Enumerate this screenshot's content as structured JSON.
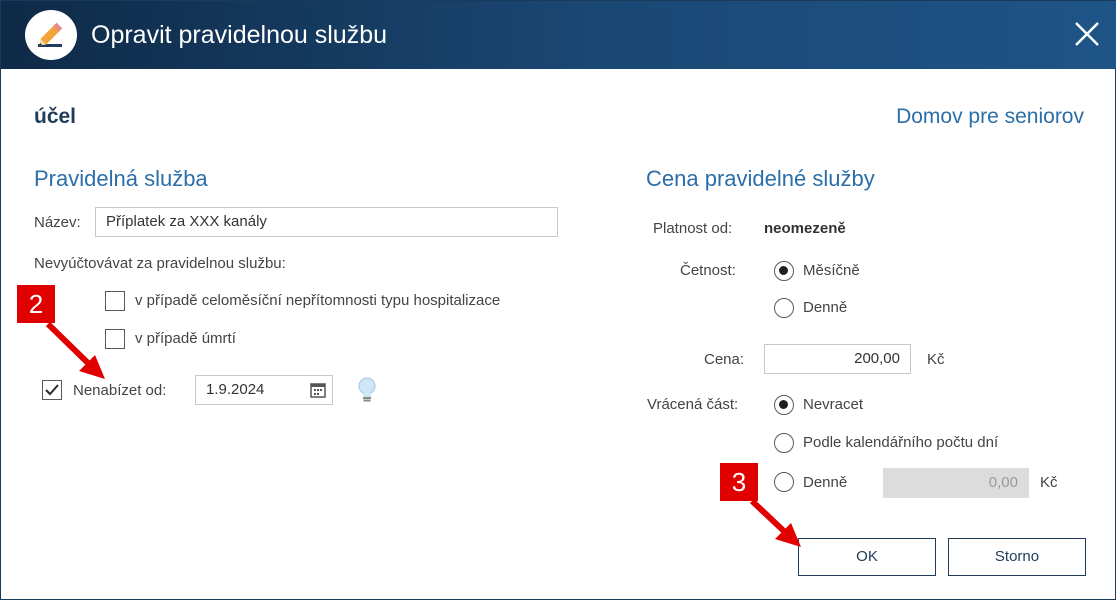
{
  "window": {
    "title": "Opravit pravidelnou službu"
  },
  "purpose": {
    "label": "účel",
    "value": "Domov pre seniorov"
  },
  "left": {
    "section_title": "Pravidelná služba",
    "name_label": "Název:",
    "name_value": "Příplatek za XXX kanály",
    "no_billing_label": "Nevyúčtovávat za pravidelnou službu:",
    "options": [
      {
        "label": "v případě celoměsíční nepřítomnosti typu hospitalizace",
        "checked": false
      },
      {
        "label": "v případě úmrtí",
        "checked": false
      }
    ],
    "offer_until": {
      "label": "Nenabízet od:",
      "checked": true,
      "date": "1.9.2024"
    }
  },
  "right": {
    "section_title": "Cena pravidelné služby",
    "validity_label": "Platnost od:",
    "validity_value": "neomezeně",
    "frequency_label": "Četnost:",
    "frequency_options": [
      {
        "label": "Měsíčně",
        "selected": true
      },
      {
        "label": "Denně",
        "selected": false
      }
    ],
    "price_label": "Cena:",
    "price_value": "200,00",
    "currency": "Kč",
    "refund_label": "Vrácená část:",
    "refund_options": [
      {
        "label": "Nevracet",
        "selected": true
      },
      {
        "label": "Podle kalendářního počtu dní",
        "selected": false
      },
      {
        "label": "Denně",
        "selected": false
      }
    ],
    "daily_value": "0,00",
    "daily_currency": "Kč"
  },
  "buttons": {
    "ok": "OK",
    "cancel": "Storno"
  },
  "callouts": {
    "step2": "2",
    "step3": "3"
  },
  "icons": {
    "app": "pencil-icon",
    "close": "close-icon",
    "calendar": "calendar-icon",
    "hint": "lightbulb-icon"
  },
  "colors": {
    "titlebar": "#1a4875",
    "accent": "#2b6ea8",
    "callout": "#e00000"
  }
}
